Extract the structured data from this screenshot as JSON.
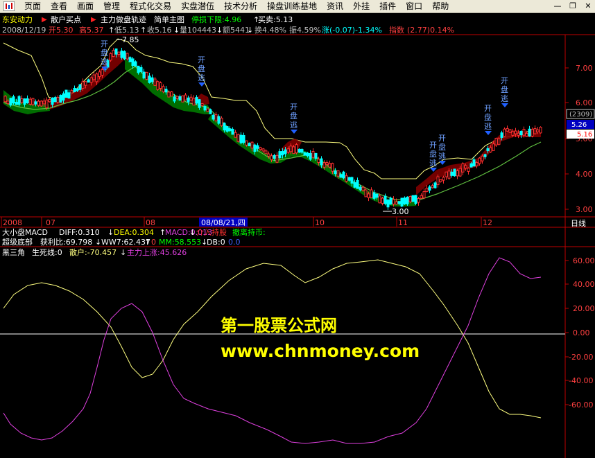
{
  "menu": {
    "items": [
      "页面",
      "查看",
      "画面",
      "管理",
      "程式化交易",
      "实盘潜伍",
      "技术分析",
      "操盘训练基地",
      "资讯",
      "外挂",
      "插件",
      "窗口",
      "帮助"
    ]
  },
  "header": {
    "stock_name": "东安动力",
    "ind1": "散户买点",
    "ind2": "主力做盘轨迹",
    "ind3": "简单主图",
    "stop_label": "停损下限:4.96",
    "buy_sell": "买卖:5.13"
  },
  "quote": {
    "date": "2008/12/19",
    "open": "开5.30",
    "high": "高5.37",
    "low": "低5.13",
    "close": "收5.16",
    "volume": "量104443",
    "amount": "额5441",
    "turnover": "换4.48%",
    "amplitude": "振4.59%",
    "change": "涨(-0.07)-1.34%",
    "index_label": "指数",
    "index_value": "(2.77)0.14%"
  },
  "price_axis": [
    "7.00",
    "6.00",
    "5.00",
    "4.00",
    "3.00"
  ],
  "price_badges": {
    "code": "(2309)",
    "p1": "5.26",
    "p2": "5.16"
  },
  "annotations": {
    "high": "7.85",
    "low": "3.00",
    "signal": "开盘逃"
  },
  "time_axis": {
    "labels": [
      "2008",
      "07",
      "08",
      "10",
      "11",
      "12"
    ],
    "cursor": "08/08/21,四",
    "period": "日线"
  },
  "sub_indicator": {
    "line1_name": "大小盘MACD",
    "diff": "DIFF:0.310",
    "dea": "DEA:0.304",
    "macd": "MACD:0.013",
    "intervene": "介入持股",
    "withdraw": "撤离持币:",
    "line2_name": "超级底部",
    "profit": "获利比:69.798",
    "ww7": "WW7:62.437",
    "zero1": "0",
    "mm": "MM:58.553",
    "db": "DB:0",
    "zero2": "0.0"
  },
  "osc_indicator": {
    "name": "黑三角",
    "life_death": "生死线:0",
    "retail": "散户:-70.457",
    "main_up": "主力上涨:45.626",
    "axis": [
      "60.00",
      "40.00",
      "20.00",
      "0.00",
      "-20.00",
      "-40.00",
      "-60.00"
    ]
  },
  "watermark": {
    "line1": "第一股票公式网",
    "line2": "www.chnmoney.com"
  },
  "colors": {
    "background": "#000000",
    "candle_up": "#ff3030",
    "candle_down": "#00ffff",
    "band_green": "#008000",
    "band_red": "#800000",
    "yellow_line": "#ffff80",
    "green_line": "#60c040",
    "magenta_line": "#e040e0",
    "axis_red": "#c00000",
    "signal_blue": "#2060ff"
  }
}
